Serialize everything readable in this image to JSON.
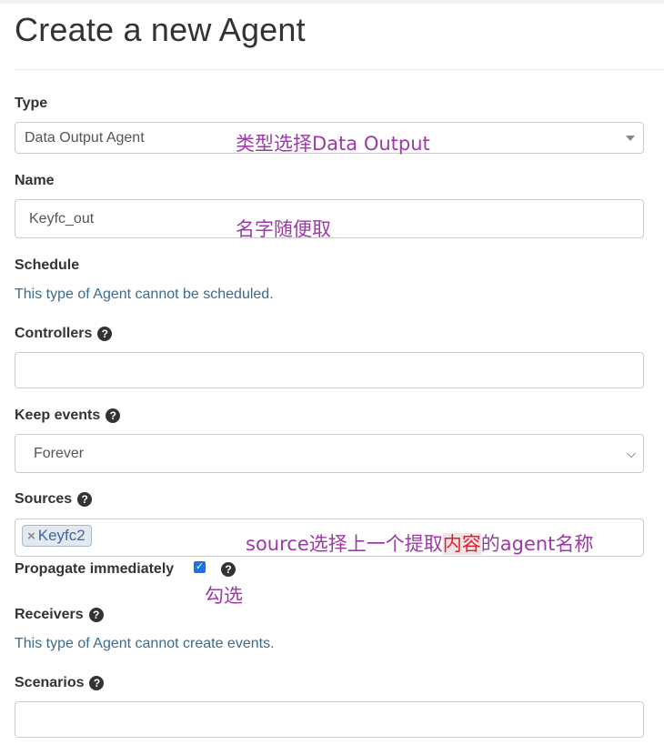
{
  "page_title": "Create a new Agent",
  "type": {
    "label": "Type",
    "value": "Data Output Agent",
    "annotation": "类型选择Data Output"
  },
  "name": {
    "label": "Name",
    "value": "Keyfc_out",
    "annotation": "名字随便取"
  },
  "schedule": {
    "label": "Schedule",
    "info": "This type of Agent cannot be scheduled."
  },
  "controllers": {
    "label": "Controllers",
    "value": ""
  },
  "keep_events": {
    "label": "Keep events",
    "value": "Forever"
  },
  "sources": {
    "label": "Sources",
    "tags": [
      "Keyfc2"
    ],
    "tag_remove": "×",
    "annotation_before": "source选择上一个提取",
    "annotation_highlight": "内容",
    "annotation_after": "的agent名称"
  },
  "propagate": {
    "label": "Propagate immediately",
    "checked": true,
    "annotation": "勾选"
  },
  "receivers": {
    "label": "Receivers",
    "info": "This type of Agent cannot create events."
  },
  "scenarios": {
    "label": "Scenarios",
    "value": ""
  },
  "icons": {
    "help": "question-circle-icon",
    "select_caret": "caret-down-icon",
    "chevron": "chevron-down-icon",
    "help_glyph": "?",
    "chevron_glyph": "⌵",
    "check_glyph": "✓"
  },
  "colors": {
    "annotation": "#9c3aa6",
    "annotation_highlight": "#e0202b",
    "info_text": "#3d6a8a",
    "tag_text": "#3a67a8",
    "checkbox": "#1a73e8"
  }
}
